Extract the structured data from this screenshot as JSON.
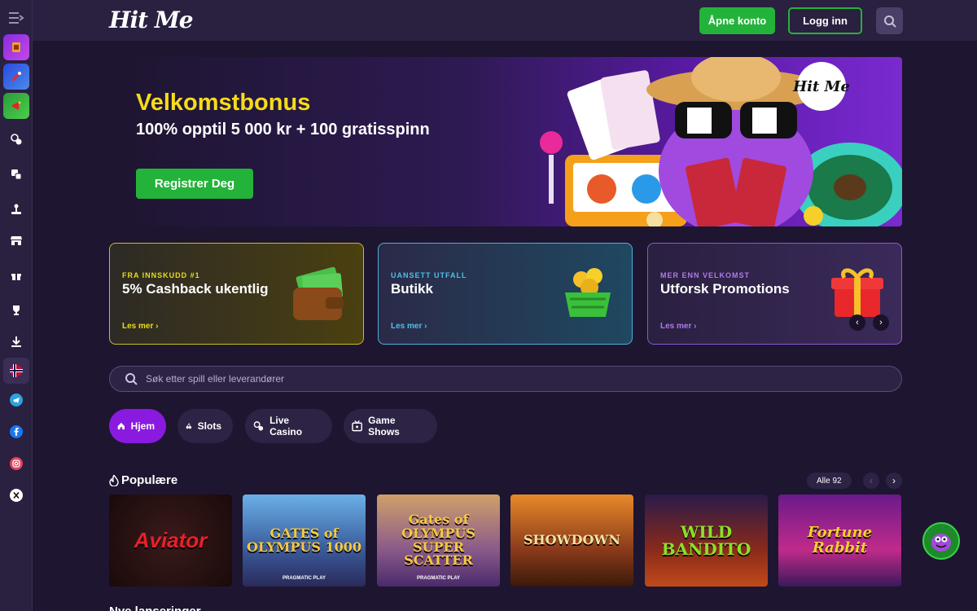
{
  "header": {
    "logo": "Hit Me",
    "open_account": "Åpne konto",
    "login": "Logg inn"
  },
  "sidebar": {
    "items": [
      {
        "icon": "menu-icon"
      },
      {
        "icon": "lucky-card-thumb"
      },
      {
        "icon": "rocket-thumb"
      },
      {
        "icon": "megaphone-thumb"
      },
      {
        "icon": "casino-chips-icon"
      },
      {
        "icon": "dice-icon"
      },
      {
        "icon": "joystick-icon"
      },
      {
        "icon": "shop-icon"
      },
      {
        "icon": "gift-icon"
      },
      {
        "icon": "trophy-icon"
      },
      {
        "icon": "download-icon"
      },
      {
        "icon": "norway-flag-icon"
      },
      {
        "icon": "telegram-icon"
      },
      {
        "icon": "facebook-icon"
      },
      {
        "icon": "instagram-icon"
      },
      {
        "icon": "x-icon"
      }
    ]
  },
  "hero": {
    "title": "Velkomstbonus",
    "subtitle": "100% opptil 5 000 kr + 100 gratisspinn",
    "cta": "Registrer Deg",
    "logo_badge": "Hit Me"
  },
  "promos": [
    {
      "tag": "FRA INNSKUDD #1",
      "title": "5% Cashback ukentlig",
      "link": "Les mer ›"
    },
    {
      "tag": "UANSETT UTFALL",
      "title": "Butikk",
      "link": "Les mer ›"
    },
    {
      "tag": "MER ENN VELKOMST",
      "title": "Utforsk Promotions",
      "link": "Les mer ›"
    }
  ],
  "search": {
    "placeholder": "Søk etter spill eller leverandører"
  },
  "tabs": [
    {
      "label": "Hjem",
      "active": true
    },
    {
      "label": "Slots",
      "active": false
    },
    {
      "label": "Live Casino",
      "active": false
    },
    {
      "label": "Game Shows",
      "active": false
    }
  ],
  "popular": {
    "title": "Populære",
    "all_label": "Alle",
    "all_count": "92",
    "games": [
      {
        "title": "Aviator",
        "provider": ""
      },
      {
        "title": "GATES of OLYMPUS 1000",
        "provider": "PRAGMATIC PLAY"
      },
      {
        "title": "Gates of OLYMPUS SUPER SCATTER",
        "provider": "PRAGMATIC PLAY"
      },
      {
        "title": "SHOWDOWN",
        "provider": ""
      },
      {
        "title": "WILD BANDITO",
        "provider": ""
      },
      {
        "title": "Fortune Rabbit",
        "provider": ""
      }
    ]
  },
  "new_releases": {
    "title": "Nye lanseringer"
  },
  "colors": {
    "accent_green": "#23b33a",
    "accent_purple": "#8a1ae0",
    "hero_title_yellow": "#f5dc1a",
    "background": "#1e1530"
  }
}
